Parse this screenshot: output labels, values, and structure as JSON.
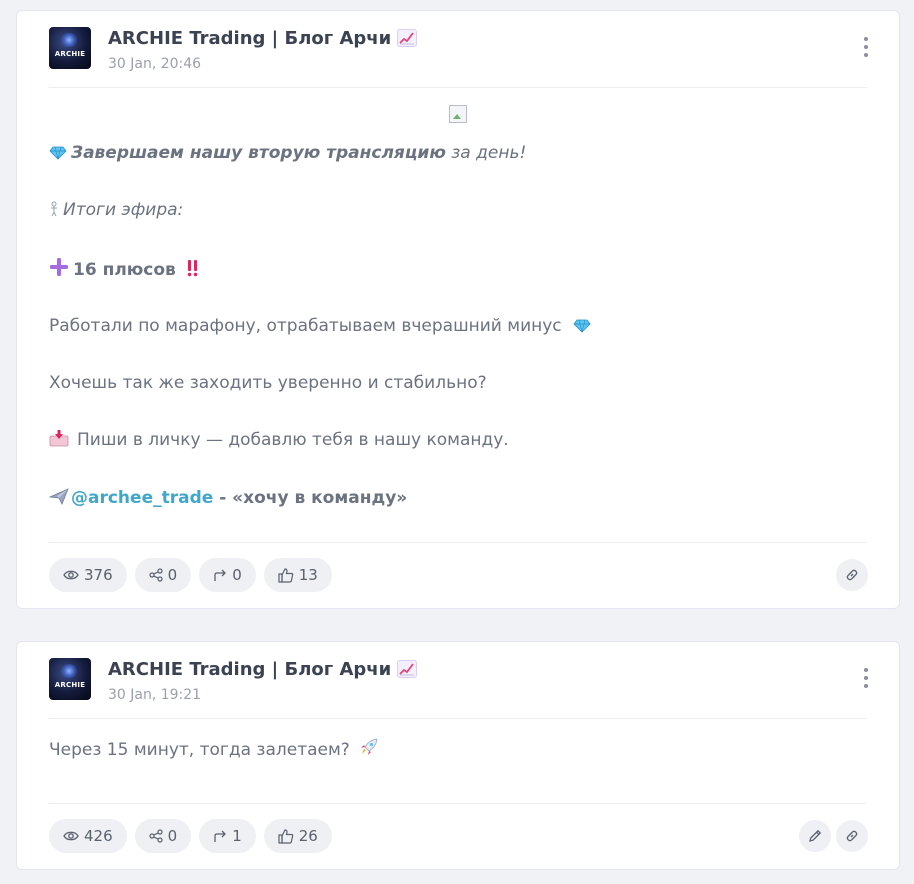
{
  "posts": [
    {
      "channel_name": "ARCHIE Trading | Блог Арчи",
      "channel_emoji": "chart-increasing-icon",
      "avatar_text": "ARCHIE",
      "time": "30 Jan, 20:46",
      "body": {
        "line1_bold_italic": "Завершаем нашу вторую трансляцию",
        "line1_italic": " за день!",
        "line2_italic": "Итоги эфира:",
        "line3_bold": "16 плюсов",
        "line4": "Работали по марафону, отрабатываем вчерашний минус",
        "line5": "Хочешь так же заходить уверенно и стабильно?",
        "line6": "Пиши в личку — добавлю тебя в нашу команду.",
        "line7_mention": "@archee_trade",
        "line7_rest": " - «хочу в команду»"
      },
      "stats": {
        "views": "376",
        "shares": "0",
        "forwards": "0",
        "likes": "13"
      }
    },
    {
      "channel_name": "ARCHIE Trading | Блог Арчи",
      "channel_emoji": "chart-increasing-icon",
      "avatar_text": "ARCHIE",
      "time": "30 Jan, 19:21",
      "body": {
        "line1": "Через 15 минут, тогда залетаем?"
      },
      "stats": {
        "views": "426",
        "shares": "0",
        "forwards": "1",
        "likes": "26"
      }
    }
  ],
  "colors": {
    "page_bg": "#f1f2f6",
    "card_bg": "#ffffff",
    "text": "#6b7280",
    "title": "#3b4252",
    "mention": "#3fa7c9",
    "pill_bg": "#eef0f4"
  }
}
